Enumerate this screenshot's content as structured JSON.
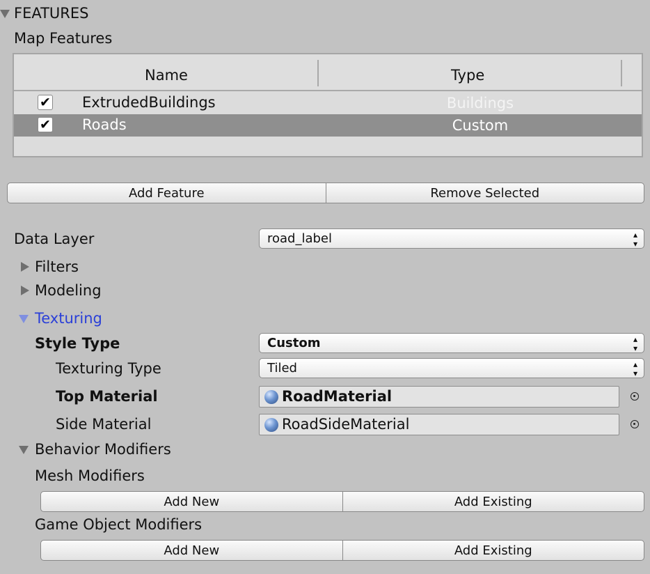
{
  "header": {
    "section_title": "FEATURES",
    "subtitle": "Map Features"
  },
  "table": {
    "columns": [
      "Name",
      "Type"
    ],
    "rows": [
      {
        "checked": true,
        "checkmark": "✔",
        "name": "ExtrudedBuildings",
        "type": "Buildings",
        "selected": false
      },
      {
        "checked": true,
        "checkmark": "✔",
        "name": "Roads",
        "type": "Custom",
        "selected": true
      }
    ]
  },
  "feature_buttons": {
    "add": "Add Feature",
    "remove": "Remove Selected"
  },
  "data_layer": {
    "label": "Data Layer",
    "value": "road_label"
  },
  "sections": {
    "filters": "Filters",
    "modeling": "Modeling",
    "texturing": "Texturing",
    "behavior": "Behavior Modifiers"
  },
  "texturing": {
    "style_type_label": "Style Type",
    "style_type_value": "Custom",
    "texturing_type_label": "Texturing Type",
    "texturing_type_value": "Tiled",
    "top_material_label": "Top Material",
    "top_material_value": "RoadMaterial",
    "side_material_label": "Side Material",
    "side_material_value": "RoadSideMaterial"
  },
  "modifiers": {
    "mesh_label": "Mesh Modifiers",
    "mesh_add_new": "Add New",
    "mesh_add_existing": "Add Existing",
    "go_label": "Game Object Modifiers",
    "go_add_new": "Add New",
    "go_add_existing": "Add Existing"
  },
  "colors": {
    "background": "#c2c2c2",
    "selected_row": "#8f8f8f",
    "foldout_active": "#2a3fd8"
  }
}
